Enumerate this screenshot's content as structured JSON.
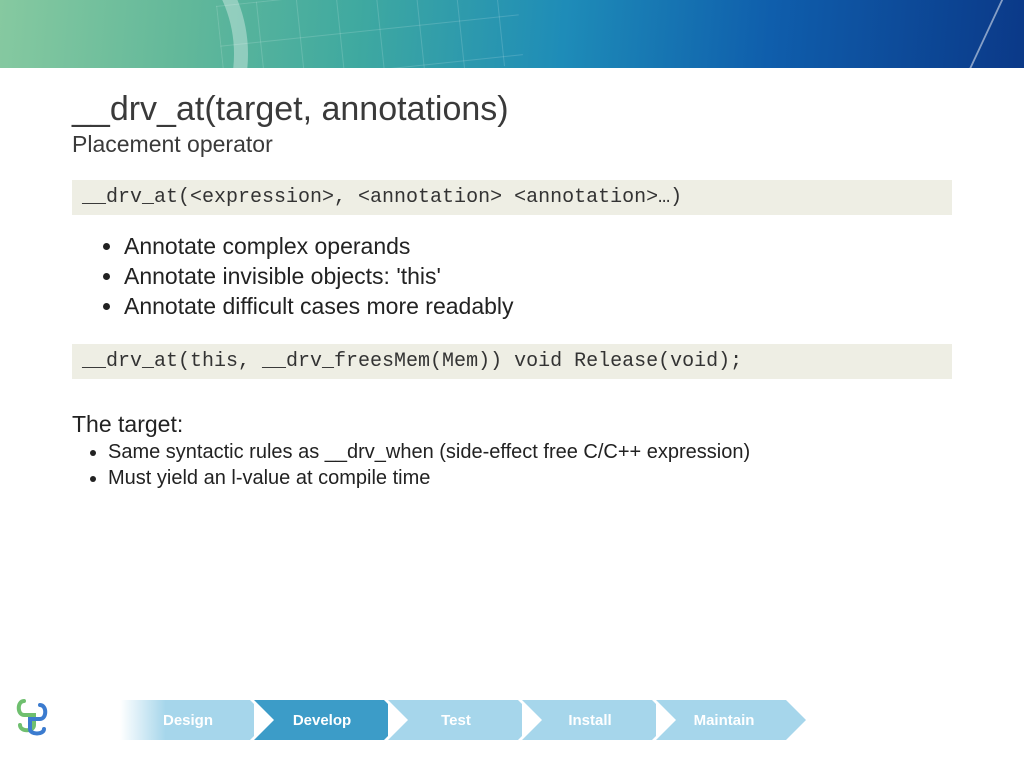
{
  "header": {
    "title": "__drv_at(target, annotations)",
    "subtitle": "Placement operator"
  },
  "codebox1": "__drv_at(<expression>, <annotation> <annotation>…)",
  "bullets1": [
    "Annotate complex operands",
    "Annotate invisible objects: 'this'",
    "Annotate difficult cases more readably"
  ],
  "codebox2": "__drv_at(this, __drv_freesMem(Mem)) void Release(void);",
  "section_label": "The target:",
  "bullets2": [
    "Same syntactic rules as __drv_when (side-effect free C/C++ expression)",
    "Must yield an l-value at compile time"
  ],
  "footer_steps": [
    "Design",
    "Develop",
    "Test",
    "Install",
    "Maintain"
  ],
  "active_step_index": 1
}
